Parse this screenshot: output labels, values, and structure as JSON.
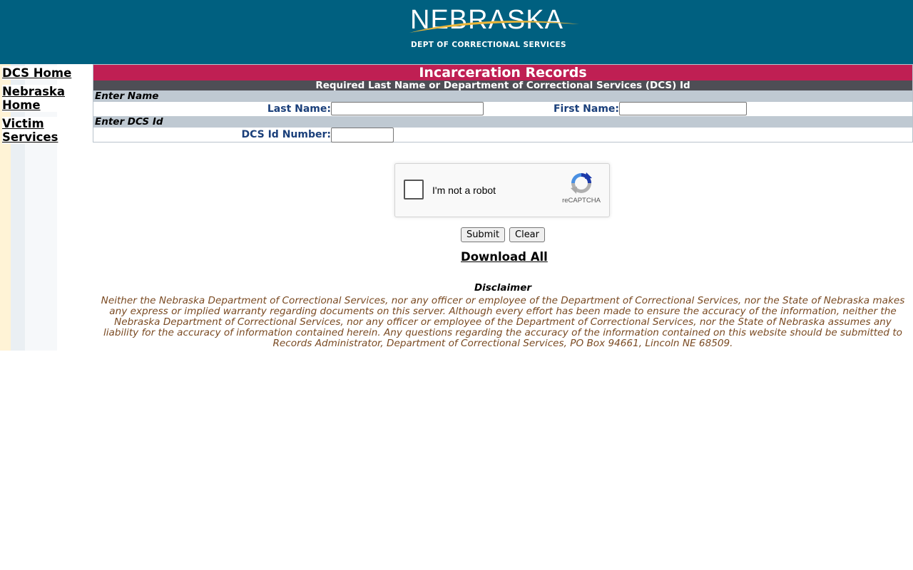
{
  "header": {
    "logo_word": "NEBRASKA",
    "logo_sub": "DEPT OF CORRECTIONAL SERVICES",
    "bg_color": "#006080"
  },
  "sidebar": {
    "links": [
      {
        "label": "DCS Home"
      },
      {
        "label": "Nebraska Home"
      },
      {
        "label": "Victim Services"
      }
    ]
  },
  "panel": {
    "title": "Incarceration Records",
    "subtitle": "Required Last Name or Department of Correctional Services (DCS) Id",
    "title_color": "#bf1f53",
    "name_section": "Enter Name",
    "last_name_label": "Last Name:",
    "last_name_value": "",
    "first_name_label": "First Name:",
    "first_name_value": "",
    "id_section": "Enter DCS Id",
    "id_label": "DCS Id Number:",
    "id_value": ""
  },
  "captcha": {
    "label": "I'm not a robot",
    "brand": "reCAPTCHA",
    "checked": false
  },
  "actions": {
    "submit_label": "Submit",
    "clear_label": "Clear",
    "download_label": "Download All"
  },
  "disclaimer": {
    "title": "Disclaimer",
    "text": "Neither the Nebraska Department of Correctional Services, nor any officer or employee of the Department of Correctional Services, nor the State of Nebraska makes any express or implied warranty regarding documents on this server. Although every effort has been made to ensure the accuracy of the information, neither the Nebraska Department of Correctional Services, nor any officer or employee of the Department of Correctional Services, nor the State of Nebraska assumes any liability for the accuracy of information contained herein. Any questions regarding the accuracy of the information contained on this website should be submitted to Records Administrator, Department of Correctional Services, PO Box 94661, Lincoln NE 68509."
  }
}
